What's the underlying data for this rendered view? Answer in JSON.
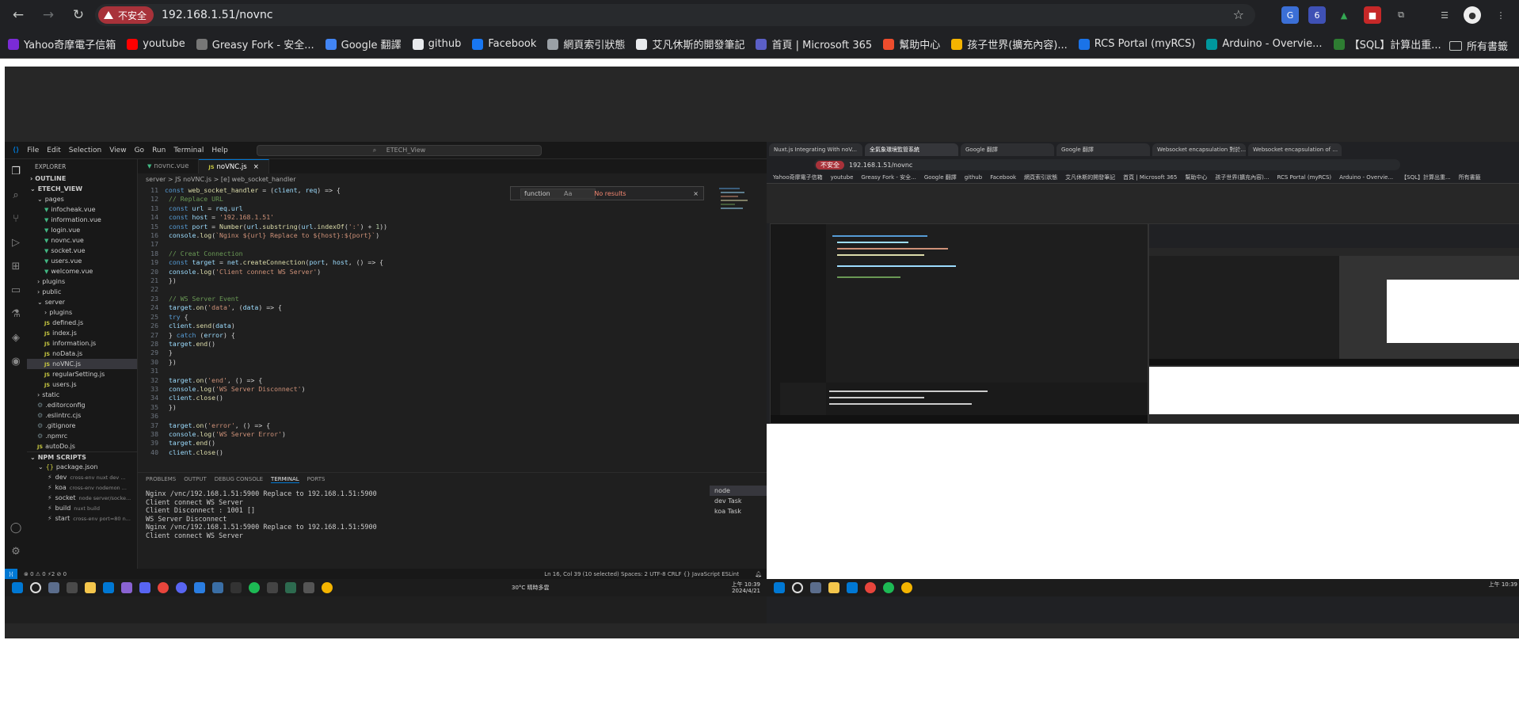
{
  "browser": {
    "security_label": "不安全",
    "url": "192.168.1.51/novnc",
    "ext_badge": "6",
    "bookmarks": [
      {
        "label": "Yahoo奇摩電子信箱",
        "color": "#7b2bd6"
      },
      {
        "label": "youtube",
        "color": "#ff0000"
      },
      {
        "label": "Greasy Fork - 安全...",
        "color": "#777777"
      },
      {
        "label": "Google 翻譯",
        "color": "#4285f4"
      },
      {
        "label": "github",
        "color": "#e8eaed"
      },
      {
        "label": "Facebook",
        "color": "#1877f2"
      },
      {
        "label": "網頁索引狀態",
        "color": "#9aa0a6"
      },
      {
        "label": "艾凡休斯的開發筆記",
        "color": "#e8eaed"
      },
      {
        "label": "首頁 | Microsoft 365",
        "color": "#5b5fc7"
      },
      {
        "label": "幫助中心",
        "color": "#ee4d2d"
      },
      {
        "label": "孩子世界(擴充內容)...",
        "color": "#f4b400"
      },
      {
        "label": "RCS Portal (myRCS)",
        "color": "#1a73e8"
      },
      {
        "label": "Arduino - Overvie...",
        "color": "#00979d"
      },
      {
        "label": "【SQL】計算出重...",
        "color": "#2e7d32"
      }
    ],
    "all_bookmarks": "所有書籤"
  },
  "vscode": {
    "menu": [
      "File",
      "Edit",
      "Selection",
      "View",
      "Go",
      "Run",
      "Terminal",
      "Help"
    ],
    "search": "ETECH_View",
    "explorer_title": "EXPLORER",
    "outline": "OUTLINE",
    "project": "ETECH_VIEW",
    "tree": [
      {
        "label": "pages",
        "kind": "folder",
        "indent": 1
      },
      {
        "label": "infocheak.vue",
        "kind": "vue",
        "indent": 2
      },
      {
        "label": "information.vue",
        "kind": "vue",
        "indent": 2
      },
      {
        "label": "login.vue",
        "kind": "vue",
        "indent": 2
      },
      {
        "label": "novnc.vue",
        "kind": "vue",
        "indent": 2
      },
      {
        "label": "socket.vue",
        "kind": "vue",
        "indent": 2
      },
      {
        "label": "users.vue",
        "kind": "vue",
        "indent": 2
      },
      {
        "label": "welcome.vue",
        "kind": "vue",
        "indent": 2
      },
      {
        "label": "plugins",
        "kind": "closed",
        "indent": 1
      },
      {
        "label": "public",
        "kind": "closed",
        "indent": 1
      },
      {
        "label": "server",
        "kind": "folder",
        "indent": 1
      },
      {
        "label": "plugins",
        "kind": "closed",
        "indent": 2
      },
      {
        "label": "defined.js",
        "kind": "js",
        "indent": 2
      },
      {
        "label": "index.js",
        "kind": "js",
        "indent": 2
      },
      {
        "label": "information.js",
        "kind": "js",
        "indent": 2
      },
      {
        "label": "noData.js",
        "kind": "js",
        "indent": 2
      },
      {
        "label": "noVNC.js",
        "kind": "js",
        "indent": 2,
        "selected": true
      },
      {
        "label": "regularSetting.js",
        "kind": "js",
        "indent": 2
      },
      {
        "label": "users.js",
        "kind": "js",
        "indent": 2
      },
      {
        "label": "static",
        "kind": "closed",
        "indent": 1
      },
      {
        "label": ".editorconfig",
        "kind": "cfg",
        "indent": 1
      },
      {
        "label": ".eslintrc.cjs",
        "kind": "cfg",
        "indent": 1
      },
      {
        "label": ".gitignore",
        "kind": "cfg",
        "indent": 1
      },
      {
        "label": ".npmrc",
        "kind": "cfg",
        "indent": 1
      },
      {
        "label": "autoDo.js",
        "kind": "js",
        "indent": 1
      }
    ],
    "npm_title": "NPM SCRIPTS",
    "npm_pkg": "package.json",
    "npm_scripts": [
      {
        "name": "dev",
        "cmd": "cross-env nuxt dev ..."
      },
      {
        "name": "koa",
        "cmd": "cross-env nodemon ..."
      },
      {
        "name": "socket",
        "cmd": "node server/socke..."
      },
      {
        "name": "build",
        "cmd": "nuxt build"
      },
      {
        "name": "start",
        "cmd": "cross-env port=80 n..."
      }
    ],
    "tabs": [
      "novnc.vue",
      "noVNC.js"
    ],
    "breadcrumb": "server > JS noVNC.js > [e] web_socket_handler",
    "find_value": "function",
    "find_result": "No results",
    "code": [
      {
        "n": "11",
        "h": "<span class=\"kw\">const</span> <span class=\"fn\">web_socket_handler</span> = (<span class=\"var\">client</span>, <span class=\"var\">req</span>) =&gt; {"
      },
      {
        "n": "12",
        "h": "  <span class=\"cm\">// Replace URL</span>"
      },
      {
        "n": "13",
        "h": "  <span class=\"kw\">const</span> <span class=\"var\">url</span> = <span class=\"var\">req</span>.<span class=\"var\">url</span>"
      },
      {
        "n": "14",
        "h": "  <span class=\"kw\">const</span> <span class=\"var\">host</span> = <span class=\"str\">'192.168.1.51'</span>"
      },
      {
        "n": "15",
        "h": "  <span class=\"kw\">const</span> <span class=\"var\">port</span> = <span class=\"fn\">Number</span>(<span class=\"var\">url</span>.<span class=\"fn\">substring</span>(<span class=\"var\">url</span>.<span class=\"fn\">indexOf</span>(<span class=\"str\">':'</span>) + <span class=\"num\">1</span>))"
      },
      {
        "n": "16",
        "h": "  <span class=\"var\">console</span>.<span class=\"fn\">log</span>(<span class=\"str\">`Nginx ${url} Replace to ${host}:${port}`</span>)"
      },
      {
        "n": "17",
        "h": ""
      },
      {
        "n": "18",
        "h": "  <span class=\"cm\">// Creat Connection</span>"
      },
      {
        "n": "19",
        "h": "  <span class=\"kw\">const</span> <span class=\"var\">target</span> = <span class=\"var\">net</span>.<span class=\"fn\">createConnection</span>(<span class=\"var\">port</span>, <span class=\"var\">host</span>, () =&gt; {"
      },
      {
        "n": "20",
        "h": "    <span class=\"var\">console</span>.<span class=\"fn\">log</span>(<span class=\"str\">'Client connect WS Server'</span>)"
      },
      {
        "n": "21",
        "h": "  })"
      },
      {
        "n": "22",
        "h": ""
      },
      {
        "n": "23",
        "h": "  <span class=\"cm\">// WS Server Event</span>"
      },
      {
        "n": "24",
        "h": "  <span class=\"var\">target</span>.<span class=\"fn\">on</span>(<span class=\"str\">'data'</span>, (<span class=\"var\">data</span>) =&gt; {"
      },
      {
        "n": "25",
        "h": "    <span class=\"kw\">try</span> {"
      },
      {
        "n": "26",
        "h": "      <span class=\"var\">client</span>.<span class=\"fn\">send</span>(<span class=\"var\">data</span>)"
      },
      {
        "n": "27",
        "h": "    } <span class=\"kw\">catch</span> (<span class=\"var\">error</span>) {"
      },
      {
        "n": "28",
        "h": "      <span class=\"var\">target</span>.<span class=\"fn\">end</span>()"
      },
      {
        "n": "29",
        "h": "    }"
      },
      {
        "n": "30",
        "h": "  })"
      },
      {
        "n": "31",
        "h": ""
      },
      {
        "n": "32",
        "h": "  <span class=\"var\">target</span>.<span class=\"fn\">on</span>(<span class=\"str\">'end'</span>, () =&gt; {"
      },
      {
        "n": "33",
        "h": "    <span class=\"var\">console</span>.<span class=\"fn\">log</span>(<span class=\"str\">'WS Server Disconnect'</span>)"
      },
      {
        "n": "34",
        "h": "    <span class=\"var\">client</span>.<span class=\"fn\">close</span>()"
      },
      {
        "n": "35",
        "h": "  })"
      },
      {
        "n": "36",
        "h": ""
      },
      {
        "n": "37",
        "h": "  <span class=\"var\">target</span>.<span class=\"fn\">on</span>(<span class=\"str\">'error'</span>, () =&gt; {"
      },
      {
        "n": "38",
        "h": "    <span class=\"var\">console</span>.<span class=\"fn\">log</span>(<span class=\"str\">'WS Server Error'</span>)"
      },
      {
        "n": "39",
        "h": "    <span class=\"var\">target</span>.<span class=\"fn\">end</span>()"
      },
      {
        "n": "40",
        "h": "    <span class=\"var\">client</span>.<span class=\"fn\">close</span>()"
      }
    ],
    "panel_tabs": [
      "PROBLEMS",
      "OUTPUT",
      "DEBUG CONSOLE",
      "TERMINAL",
      "PORTS"
    ],
    "terminal": [
      "Nginx /vnc/192.168.1.51:5900 Replace to 192.168.1.51:5900",
      "Client connect WS Server",
      "Client Disconnect : 1001 []",
      "WS Server Disconnect",
      "Nginx /vnc/192.168.1.51:5900 Replace to 192.168.1.51:5900",
      "Client connect WS Server"
    ],
    "terminal_list": [
      "node",
      "dev Task",
      "koa Task"
    ],
    "status_left": "⊗ 0 ⚠ 0   ⚡2   ⊘ 0",
    "status_right": "Ln 16, Col 39 (10 selected)   Spaces: 2   UTF-8   CRLF   {} JavaScript   ESLint",
    "tray_weather": "30°C 晴時多雲",
    "tray_time": "上午 10:39",
    "tray_date": "2024/4/21"
  },
  "remote_chrome": {
    "tabs": [
      "Nuxt.js Integrating With noV...",
      "全氣象環境監管系統",
      "Google 翻譯",
      "Google 翻譯",
      "Websocket encapsulation 對於...",
      "Websocket encapsulation of ..."
    ],
    "url": "192.168.1.51/novnc",
    "security_label": "不安全",
    "bookmarks": [
      "Yahoo奇摩電子信箱",
      "youtube",
      "Greasy Fork - 安全...",
      "Google 翻譯",
      "github",
      "Facebook",
      "網頁索引狀態",
      "艾凡休斯的開發筆記",
      "首頁 | Microsoft 365",
      "幫助中心",
      "孩子世界(擴充內容)...",
      "RCS Portal (myRCS)",
      "Arduino - Overvie...",
      "【SQL】計算出重...",
      "所有書籤"
    ],
    "tray_time": "上午 10:39"
  },
  "colors": {
    "accent": "#0078d4",
    "insecure": "#a8323a",
    "chrome_bg": "#202124"
  }
}
